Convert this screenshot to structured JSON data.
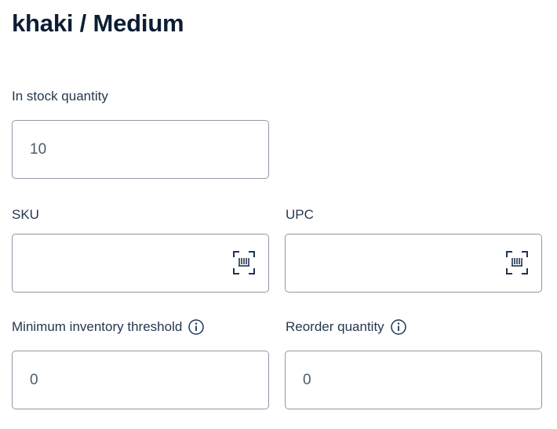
{
  "header": {
    "title": "khaki / Medium"
  },
  "fields": {
    "in_stock": {
      "label": "In stock quantity",
      "value": "10"
    },
    "sku": {
      "label": "SKU",
      "value": "",
      "icon": "barcode-scan-icon"
    },
    "upc": {
      "label": "UPC",
      "value": "",
      "icon": "barcode-scan-icon"
    },
    "min_threshold": {
      "label": "Minimum inventory threshold",
      "value": "0",
      "icon": "info-icon"
    },
    "reorder_qty": {
      "label": "Reorder quantity",
      "value": "0",
      "icon": "info-icon"
    }
  },
  "colors": {
    "text": "#0c1d33",
    "label": "#24384f",
    "border": "#8f99a5",
    "icon": "#1f3550"
  }
}
